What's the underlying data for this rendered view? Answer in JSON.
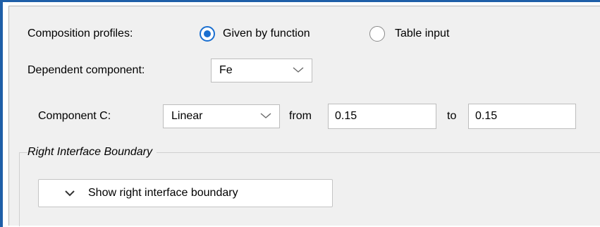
{
  "composition": {
    "label": "Composition profiles:",
    "options": [
      {
        "label": "Given by function",
        "selected": true
      },
      {
        "label": "Table input",
        "selected": false
      }
    ]
  },
  "dependent": {
    "label": "Dependent component:",
    "value": "Fe"
  },
  "component_c": {
    "label": "Component C:",
    "profile": "Linear",
    "from_label": "from",
    "from_value": "0.15",
    "to_label": "to",
    "to_value": "0.15"
  },
  "right_boundary": {
    "title": "Right Interface Boundary",
    "button_label": "Show right interface boundary"
  },
  "colors": {
    "accent": "#1a6fd0",
    "window_border": "#1f5fa8",
    "panel_bg": "#f0f0f0"
  },
  "icons": {
    "combo_arrow": "chevron-down-icon",
    "button_arrow": "chevron-down-icon"
  }
}
